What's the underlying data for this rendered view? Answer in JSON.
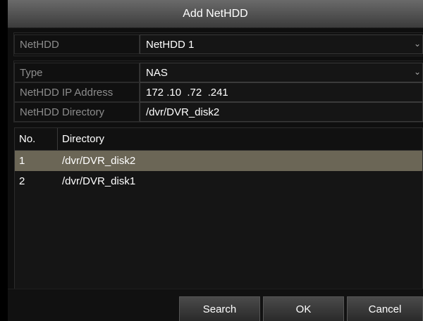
{
  "dialog": {
    "title": "Add NetHDD"
  },
  "fields": {
    "nethdd": {
      "label": "NetHDD",
      "value": "NetHDD 1"
    },
    "type": {
      "label": "Type",
      "value": "NAS"
    },
    "ip": {
      "label": "NetHDD IP Address",
      "value": "172 .10  .72  .241"
    },
    "directory": {
      "label": "NetHDD Directory",
      "value": "/dvr/DVR_disk2"
    }
  },
  "table": {
    "columns": [
      "No.",
      "Directory"
    ],
    "rows": [
      {
        "no": "1",
        "directory": "/dvr/DVR_disk2",
        "selected": true
      },
      {
        "no": "2",
        "directory": "/dvr/DVR_disk1",
        "selected": false
      }
    ]
  },
  "buttons": {
    "search": "Search",
    "ok": "OK",
    "cancel": "Cancel"
  },
  "icons": {
    "dropdown": "chevron-down-icon"
  },
  "colors": {
    "selected_row": "#6b6656"
  }
}
